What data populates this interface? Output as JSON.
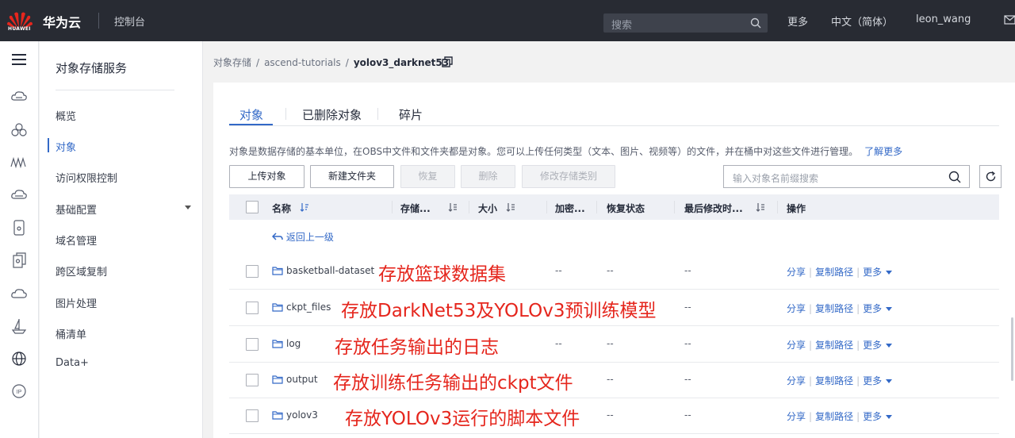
{
  "topbar": {
    "logo_text": "HUAWEI",
    "brand": "华为云",
    "console": "控制台",
    "search_placeholder": "搜索",
    "more": "更多",
    "language": "中文（简体）",
    "user": "leon_wang",
    "brand_color": "#e5261d"
  },
  "rail": {
    "icons": [
      "menu-icon",
      "cloud-server-icon",
      "cluster-icon",
      "waveform-icon",
      "network-icon",
      "device-icon",
      "documents-icon",
      "cloud-icon",
      "ship-icon",
      "globe-icon",
      "ip-icon"
    ]
  },
  "service_nav": {
    "title": "对象存储服务",
    "items": [
      {
        "label": "概览"
      },
      {
        "label": "对象"
      },
      {
        "label": "访问权限控制"
      },
      {
        "label": "基础配置"
      },
      {
        "label": "域名管理"
      },
      {
        "label": "跨区域复制"
      },
      {
        "label": "图片处理"
      },
      {
        "label": "桶清单"
      },
      {
        "label": "Data+"
      }
    ],
    "active_index": 1
  },
  "breadcrumb": {
    "root": "对象存储",
    "bucket": "ascend-tutorials",
    "current": "yolov3_darknet53"
  },
  "tabs": [
    {
      "label": "对象"
    },
    {
      "label": "已删除对象"
    },
    {
      "label": "碎片"
    }
  ],
  "description": {
    "text": "对象是数据存储的基本单位，在OBS中文件和文件夹都是对象。您可以上传任何类型（文本、图片、视频等）的文件，并在桶中对这些文件进行管理。",
    "link": "了解更多"
  },
  "toolbar": {
    "upload": "上传对象",
    "new_folder": "新建文件夹",
    "restore": "恢复",
    "delete": "删除",
    "change_storage": "修改存储类别",
    "filter_placeholder": "输入对象名前缀搜索"
  },
  "table": {
    "headers": {
      "name": "名称",
      "storage": "存储...",
      "size": "大小",
      "encrypt": "加密...",
      "restore_status": "恢复状态",
      "modified": "最后修改时...",
      "actions": "操作"
    },
    "back": "返回上一级",
    "rows": [
      {
        "name": "basketball-dataset",
        "annotation": "存放篮球数据集",
        "storage": "--",
        "restore": "--",
        "modified": "--"
      },
      {
        "name": "ckpt_files",
        "annotation": "存放DarkNet53及YOLOv3预训练模型",
        "storage": "",
        "restore": "",
        "modified": "--"
      },
      {
        "name": "log",
        "annotation": "存放任务输出的日志",
        "storage": "--",
        "restore": "--",
        "modified": "--"
      },
      {
        "name": "output",
        "annotation": "存放训练任务输出的ckpt文件",
        "storage": "--",
        "restore": "--",
        "modified": "--"
      },
      {
        "name": "yolov3",
        "annotation": "存放YOLOv3运行的脚本文件",
        "storage": "--",
        "restore": "--",
        "modified": "--"
      }
    ],
    "actions": {
      "share": "分享",
      "copy_path": "复制路径",
      "more": "更多"
    }
  }
}
